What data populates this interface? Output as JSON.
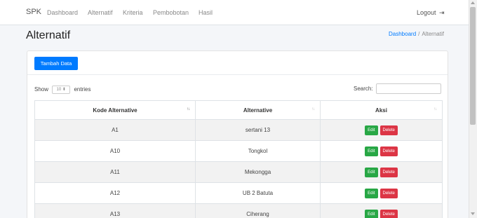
{
  "navbar": {
    "brand": "SPK",
    "links": [
      "Dashboard",
      "Alternatif",
      "Kriteria",
      "Pembobotan",
      "Hasil"
    ],
    "logout_label": "Logout",
    "logout_icon": "sign-out-icon"
  },
  "page": {
    "title": "Alternatif",
    "breadcrumb": {
      "home": "Dashboard",
      "separator": "/",
      "current": "Alternatif"
    }
  },
  "card": {
    "add_button_label": "Tambah Data",
    "length_control": {
      "prefix": "Show",
      "value": "10",
      "suffix": "entries"
    },
    "search_label": "Search:",
    "search_value": ""
  },
  "table": {
    "columns": [
      "Kode Alternative",
      "Alternative",
      "Aksi"
    ],
    "rows": [
      {
        "kode": "A1",
        "alternative": "sertani 13"
      },
      {
        "kode": "A10",
        "alternative": "Tongkol"
      },
      {
        "kode": "A11",
        "alternative": "Mekongga"
      },
      {
        "kode": "A12",
        "alternative": "UB 2 Batuta"
      },
      {
        "kode": "A13",
        "alternative": "Ciherang"
      }
    ],
    "edit_label": "Edit",
    "delete_label": "Delete"
  },
  "colors": {
    "primary": "#007bff",
    "edit": "#28a745",
    "delete": "#dc3545"
  }
}
